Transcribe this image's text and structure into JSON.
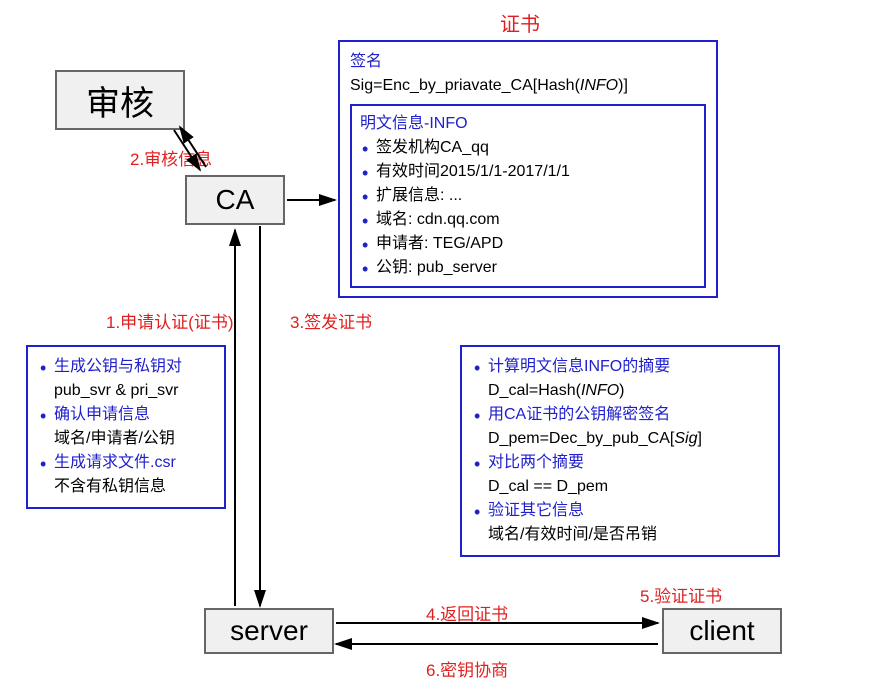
{
  "labels": {
    "title_cert": "证书",
    "step1": "1.申请认证(证书)",
    "step2": "2.审核信息",
    "step3": "3.签发证书",
    "step4": "4.返回证书",
    "step5": "5.验证证书",
    "step6": "6.密钥协商"
  },
  "nodes": {
    "audit": "审核",
    "ca": "CA",
    "server": "server",
    "client": "client"
  },
  "cert_box": {
    "sig_title": "签名",
    "sig_formula_prefix": "Sig=Enc_by_priavate_CA[Hash(",
    "sig_formula_arg": "INFO",
    "sig_formula_suffix": ")]",
    "info_title": "明文信息-INFO",
    "items": [
      "签发机构CA_qq",
      "有效时间2015/1/1-2017/1/1",
      "扩展信息: ...",
      "域名: cdn.qq.com",
      "申请者: TEG/APD",
      "公钥: pub_server"
    ]
  },
  "csr_box": {
    "l1_blue": "生成公钥与私钥对",
    "l1_line2": "pub_svr & pri_svr",
    "l2_blue": "确认申请信息",
    "l2_line2": "域名/申请者/公钥",
    "l3_blue": "生成请求文件.csr",
    "l3_line2": "不含有私钥信息"
  },
  "verify_box": {
    "l1_blue": "计算明文信息INFO的摘要",
    "l1_line2_prefix": "D_cal=Hash(",
    "l1_line2_arg": "INFO",
    "l1_line2_suffix": ")",
    "l2_blue": "用CA证书的公钥解密签名",
    "l2_line2_prefix": "D_pem=Dec_by_pub_CA[",
    "l2_line2_arg": "Sig",
    "l2_line2_suffix": "]",
    "l3_blue": "对比两个摘要",
    "l3_line2": "D_cal == D_pem",
    "l4_blue": "验证其它信息",
    "l4_line2": "域名/有效时间/是否吊销"
  }
}
